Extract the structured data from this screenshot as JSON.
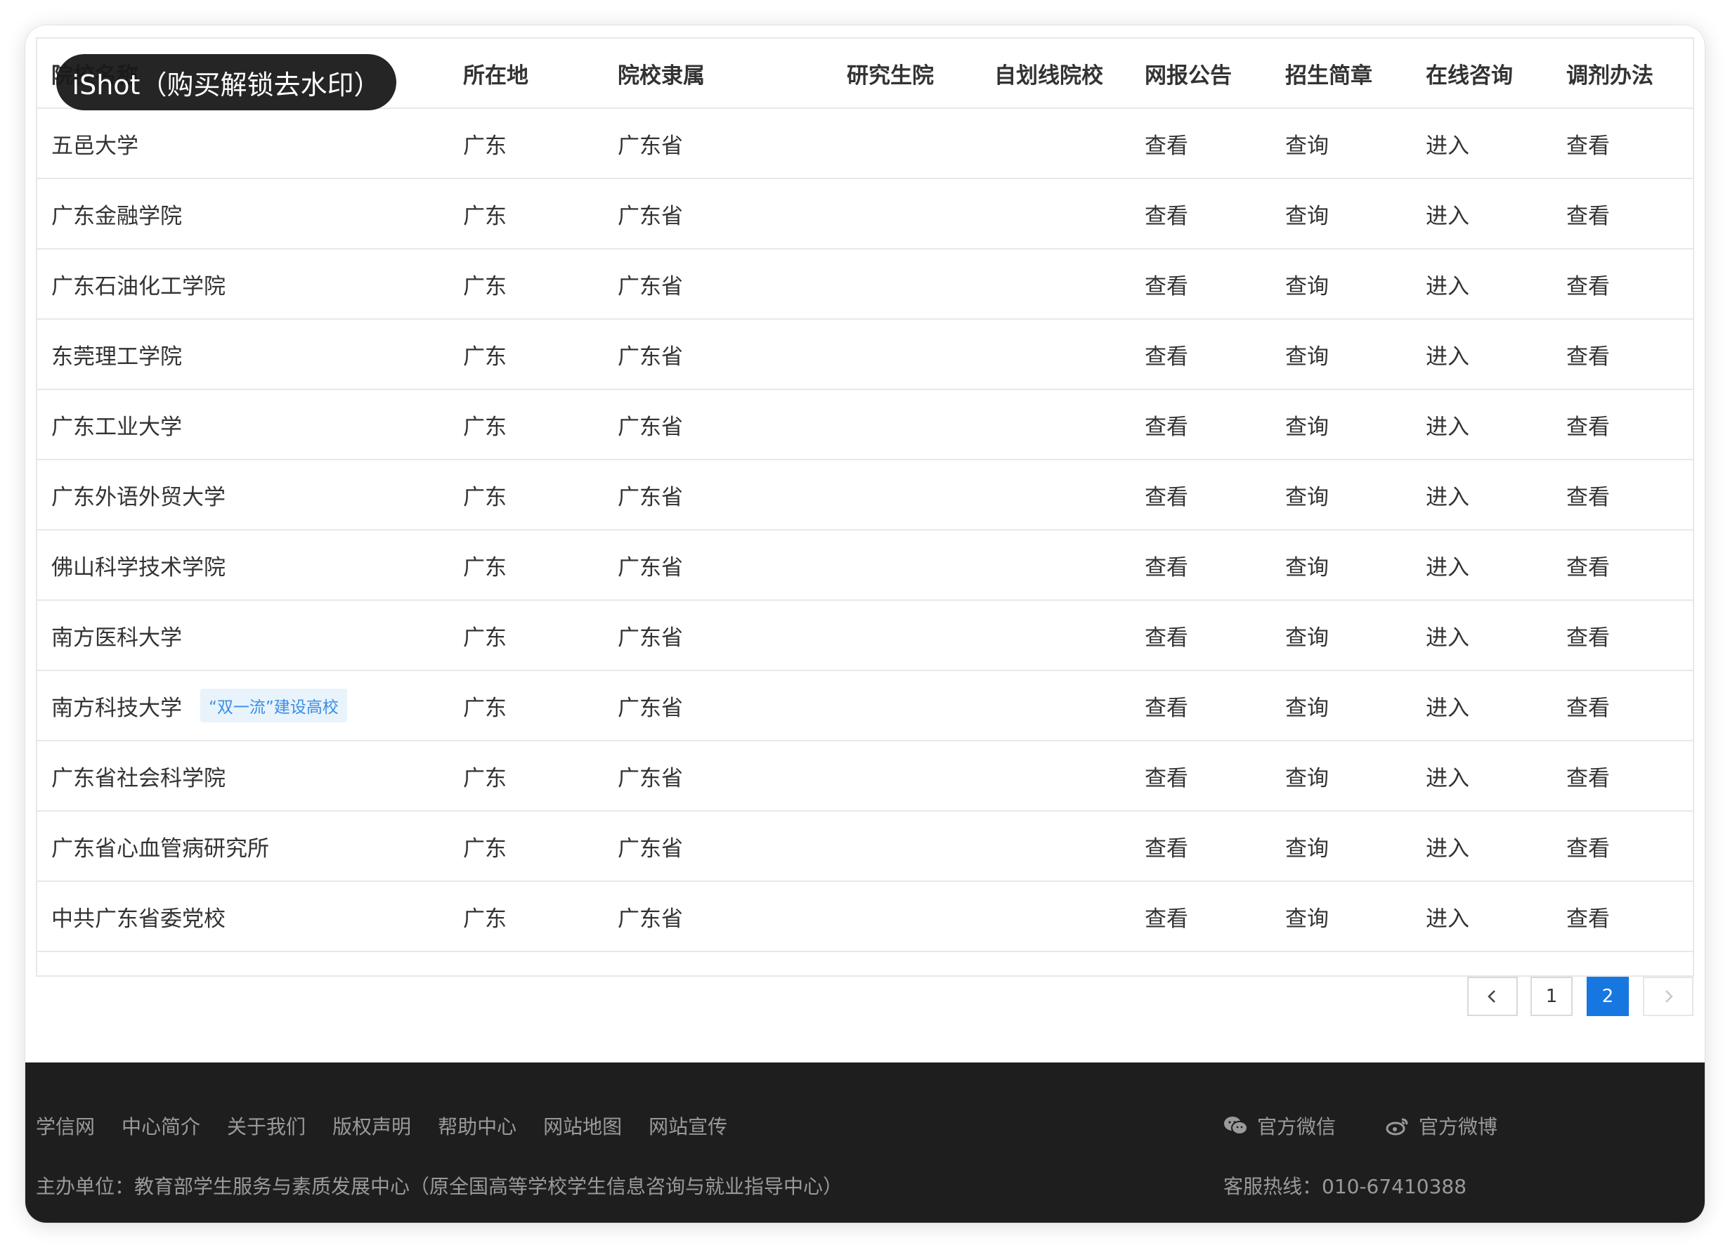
{
  "watermark": "iShot（购买解锁去水印）",
  "table": {
    "headers": [
      "院校名称",
      "所在地",
      "院校隶属",
      "研究生院",
      "自划线院校",
      "网报公告",
      "招生简章",
      "在线咨询",
      "调剂办法"
    ],
    "rows": [
      {
        "name": "五邑大学",
        "badge": "",
        "location": "广东",
        "affiliation": "广东省",
        "grad": "",
        "self": "",
        "notice": "查看",
        "brochure": "查询",
        "consult": "进入",
        "adjust": "查看"
      },
      {
        "name": "广东金融学院",
        "badge": "",
        "location": "广东",
        "affiliation": "广东省",
        "grad": "",
        "self": "",
        "notice": "查看",
        "brochure": "查询",
        "consult": "进入",
        "adjust": "查看"
      },
      {
        "name": "广东石油化工学院",
        "badge": "",
        "location": "广东",
        "affiliation": "广东省",
        "grad": "",
        "self": "",
        "notice": "查看",
        "brochure": "查询",
        "consult": "进入",
        "adjust": "查看"
      },
      {
        "name": "东莞理工学院",
        "badge": "",
        "location": "广东",
        "affiliation": "广东省",
        "grad": "",
        "self": "",
        "notice": "查看",
        "brochure": "查询",
        "consult": "进入",
        "adjust": "查看"
      },
      {
        "name": "广东工业大学",
        "badge": "",
        "location": "广东",
        "affiliation": "广东省",
        "grad": "",
        "self": "",
        "notice": "查看",
        "brochure": "查询",
        "consult": "进入",
        "adjust": "查看"
      },
      {
        "name": "广东外语外贸大学",
        "badge": "",
        "location": "广东",
        "affiliation": "广东省",
        "grad": "",
        "self": "",
        "notice": "查看",
        "brochure": "查询",
        "consult": "进入",
        "adjust": "查看"
      },
      {
        "name": "佛山科学技术学院",
        "badge": "",
        "location": "广东",
        "affiliation": "广东省",
        "grad": "",
        "self": "",
        "notice": "查看",
        "brochure": "查询",
        "consult": "进入",
        "adjust": "查看"
      },
      {
        "name": "南方医科大学",
        "badge": "",
        "location": "广东",
        "affiliation": "广东省",
        "grad": "",
        "self": "",
        "notice": "查看",
        "brochure": "查询",
        "consult": "进入",
        "adjust": "查看"
      },
      {
        "name": "南方科技大学",
        "badge": "“双一流”建设高校",
        "location": "广东",
        "affiliation": "广东省",
        "grad": "",
        "self": "",
        "notice": "查看",
        "brochure": "查询",
        "consult": "进入",
        "adjust": "查看"
      },
      {
        "name": "广东省社会科学院",
        "badge": "",
        "location": "广东",
        "affiliation": "广东省",
        "grad": "",
        "self": "",
        "notice": "查看",
        "brochure": "查询",
        "consult": "进入",
        "adjust": "查看"
      },
      {
        "name": "广东省心血管病研究所",
        "badge": "",
        "location": "广东",
        "affiliation": "广东省",
        "grad": "",
        "self": "",
        "notice": "查看",
        "brochure": "查询",
        "consult": "进入",
        "adjust": "查看"
      },
      {
        "name": "中共广东省委党校",
        "badge": "",
        "location": "广东",
        "affiliation": "广东省",
        "grad": "",
        "self": "",
        "notice": "查看",
        "brochure": "查询",
        "consult": "进入",
        "adjust": "查看"
      }
    ]
  },
  "pagination": {
    "prev_icon": "chevron-left-icon",
    "pages": [
      "1",
      "2"
    ],
    "current": "2",
    "next_icon": "chevron-right-icon",
    "active_color": "#1677e0"
  },
  "footer": {
    "links": [
      "学信网",
      "中心简介",
      "关于我们",
      "版权声明",
      "帮助中心",
      "网站地图",
      "网站宣传"
    ],
    "host": "主办单位：教育部学生服务与素质发展中心（原全国高等学校学生信息咨询与就业指导中心）",
    "wechat": "官方微信",
    "weibo": "官方微博",
    "hotline": "客服热线：010-67410388",
    "background": "#1e1e1e"
  }
}
